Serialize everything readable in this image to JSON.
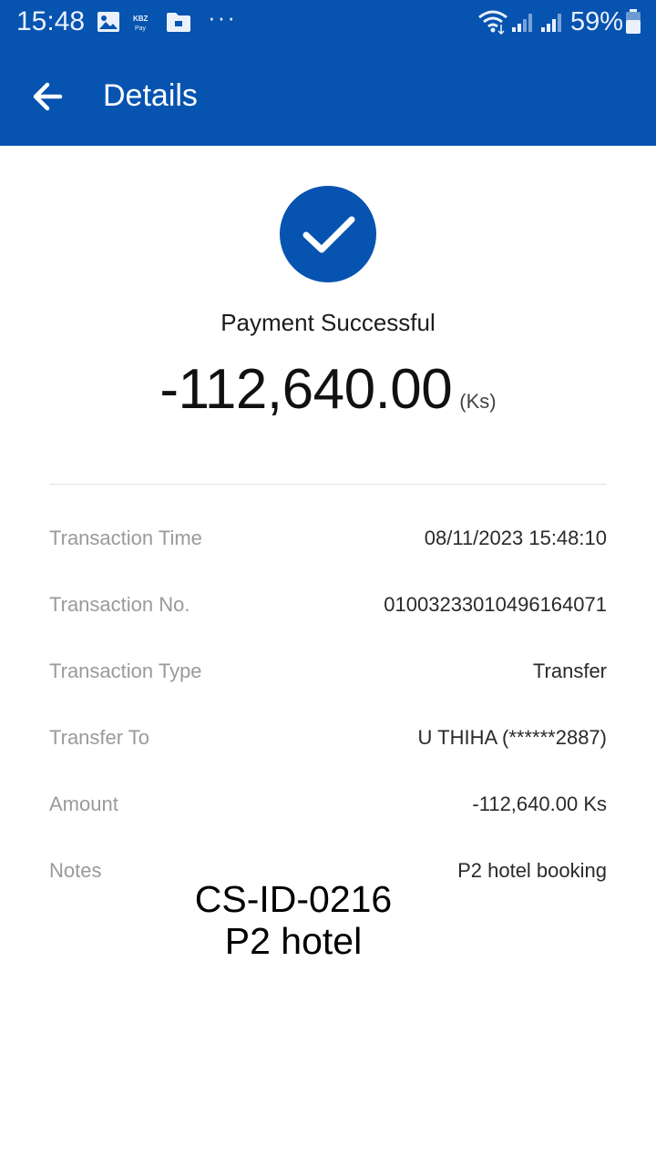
{
  "status_bar": {
    "time": "15:48",
    "icons": [
      "image-icon",
      "kbzpay-icon",
      "folder-icon"
    ],
    "more": "···",
    "battery_percent": "59%"
  },
  "app_bar": {
    "title": "Details",
    "back_icon": "arrow-left-icon"
  },
  "result": {
    "status": "Payment Successful",
    "amount": "-112,640.00",
    "unit": "(Ks)"
  },
  "details": [
    {
      "label": "Transaction Time",
      "value": "08/11/2023 15:48:10"
    },
    {
      "label": "Transaction No.",
      "value": "01003233010496164071"
    },
    {
      "label": "Transaction Type",
      "value": "Transfer"
    },
    {
      "label": "Transfer To",
      "value": "U THIHA (******2887)"
    },
    {
      "label": "Amount",
      "value": "-112,640.00 Ks"
    },
    {
      "label": "Notes",
      "value": "P2 hotel booking"
    }
  ],
  "overlay": {
    "line1": "CS-ID-0216",
    "line2": "P2 hotel"
  },
  "colors": {
    "brand": "#0653b0",
    "label": "#9a9a9a",
    "value": "#2a2a2a"
  }
}
